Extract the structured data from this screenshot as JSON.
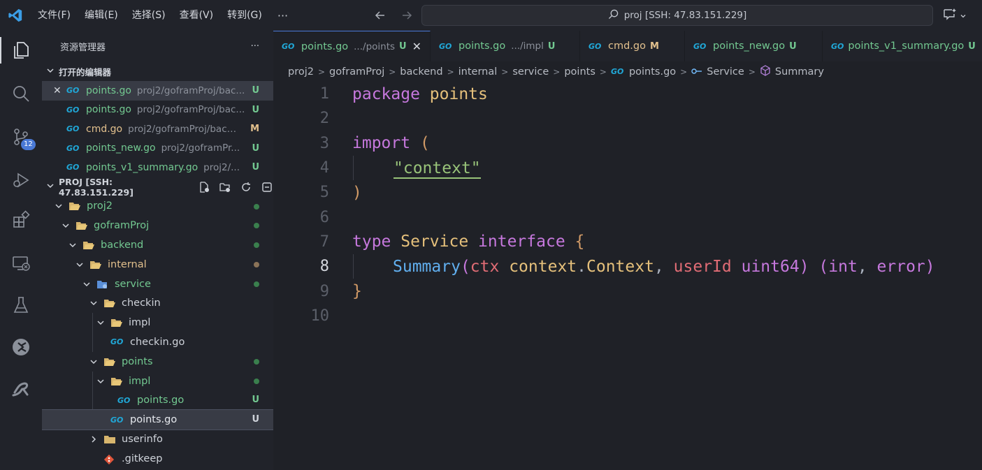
{
  "titlebar": {
    "menu": [
      "文件(F)",
      "编辑(E)",
      "选择(S)",
      "查看(V)",
      "转到(G)"
    ],
    "more": "···",
    "search_text": "proj [SSH: 47.83.151.229]",
    "icons": [
      "vscode-logo-icon",
      "back-arrow-icon",
      "forward-arrow-icon",
      "search-icon",
      "chat-icon",
      "chevron-down-icon"
    ]
  },
  "activitybar": {
    "items": [
      "explorer-icon",
      "search-icon",
      "source-control-icon",
      "run-debug-icon",
      "extensions-icon",
      "remote-explorer-icon",
      "testing-icon",
      "docker-icon",
      "remote-icon"
    ],
    "source_control_badge": "12"
  },
  "sidebar": {
    "title": "资源管理器",
    "more": "···",
    "open_editors_title": "打开的编辑器",
    "open_editors": [
      {
        "name": "points.go",
        "path": "proj2/goframProj/bac...",
        "status": "U",
        "status_color": "green",
        "selected": true
      },
      {
        "name": "points.go",
        "path": "proj2/goframProj/bac...",
        "status": "U",
        "status_color": "green"
      },
      {
        "name": "cmd.go",
        "path": "proj2/goframProj/back...",
        "status": "M",
        "status_color": "yellow"
      },
      {
        "name": "points_new.go",
        "path": "proj2/goframPr...",
        "status": "U",
        "status_color": "green"
      },
      {
        "name": "points_v1_summary.go",
        "path": "proj2/...",
        "status": "U",
        "status_color": "green"
      }
    ],
    "project_title": "PROJ [SSH: 47.83.151.229]",
    "tree": [
      {
        "label": "proj2",
        "depth": 0
      },
      {
        "label": "goframProj",
        "depth": 1
      },
      {
        "label": "backend",
        "depth": 2
      },
      {
        "label": "internal",
        "depth": 3
      },
      {
        "label": "service",
        "depth": 4
      },
      {
        "label": "checkin",
        "depth": 5
      },
      {
        "label": "impl",
        "depth": 6
      },
      {
        "label": "checkin.go",
        "depth": 6
      },
      {
        "label": "points",
        "depth": 5
      },
      {
        "label": "impl",
        "depth": 6
      },
      {
        "label": "points.go",
        "depth": 7,
        "status": "U"
      },
      {
        "label": "points.go",
        "depth": 6,
        "status": "U"
      },
      {
        "label": "userinfo",
        "depth": 5
      },
      {
        "label": ".gitkeep",
        "depth": 5
      }
    ]
  },
  "editor": {
    "tabs": [
      {
        "name": "points.go",
        "path": ".../points",
        "flag": "U",
        "active": true
      },
      {
        "name": "points.go",
        "path": ".../impl",
        "flag": "U"
      },
      {
        "name": "cmd.go",
        "path": "",
        "flag": "M"
      },
      {
        "name": "points_new.go",
        "path": "",
        "flag": "U"
      },
      {
        "name": "points_v1_summary.go",
        "path": "",
        "flag": "U"
      }
    ],
    "breadcrumb": [
      "proj2",
      "goframProj",
      "backend",
      "internal",
      "service",
      "points",
      "points.go",
      "Service",
      "Summary"
    ],
    "line_numbers": [
      "1",
      "2",
      "3",
      "4",
      "5",
      "6",
      "7",
      "8",
      "9",
      "10"
    ],
    "current_line": "8",
    "code": {
      "l1_kw": "package",
      "l1_id": "points",
      "l3_kw": "import",
      "l3_paren": "(",
      "l4_q1": "\"",
      "l4_str": "context",
      "l4_q2": "\"",
      "l5_paren": ")",
      "l7_kw": "type",
      "l7_name": "Service",
      "l7_kw2": "interface",
      "l7_brace": "{",
      "l8_fn": "Summary",
      "l8_p1": "(",
      "l8_ctx": "ctx",
      "l8_pkg": "context",
      "l8_dot": ".",
      "l8_type": "Context",
      "l8_comma": ",",
      "l8_uid": "userId",
      "l8_uint": "uint64",
      "l8_p2": ")",
      "l8_p3": "(",
      "l8_int": "int",
      "l8_comma2": ",",
      "l8_err": "error",
      "l8_p4": ")",
      "l9_brace": "}"
    }
  }
}
